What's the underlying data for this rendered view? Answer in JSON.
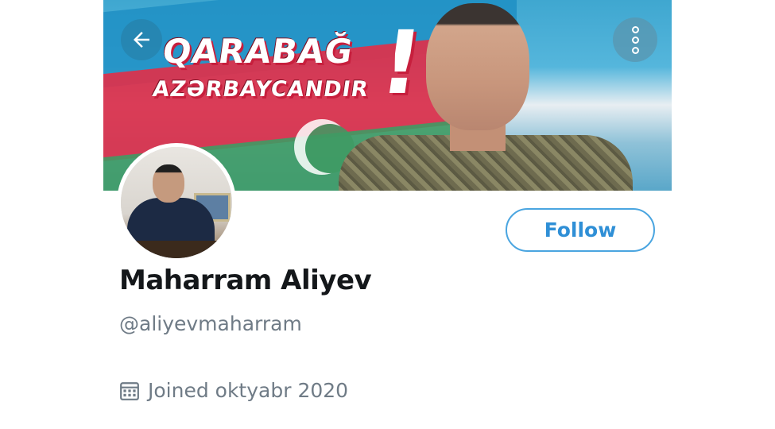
{
  "banner": {
    "line1": "QARABAĞ",
    "line2": "AZƏRBAYCANDIR",
    "exclamation": "!"
  },
  "nav": {
    "back_icon": "arrow-left-icon",
    "more_icon": "more-vertical-icon"
  },
  "profile": {
    "display_name": "Maharram Aliyev",
    "handle": "@aliyevmaharram",
    "joined_text": "Joined oktyabr 2020",
    "joined_icon": "calendar-icon"
  },
  "actions": {
    "follow_label": "Follow"
  },
  "colors": {
    "accent": "#2f8fd6",
    "follow_border": "#4aa5e0",
    "muted_text": "#6f7b86",
    "name_text": "#14171a"
  }
}
